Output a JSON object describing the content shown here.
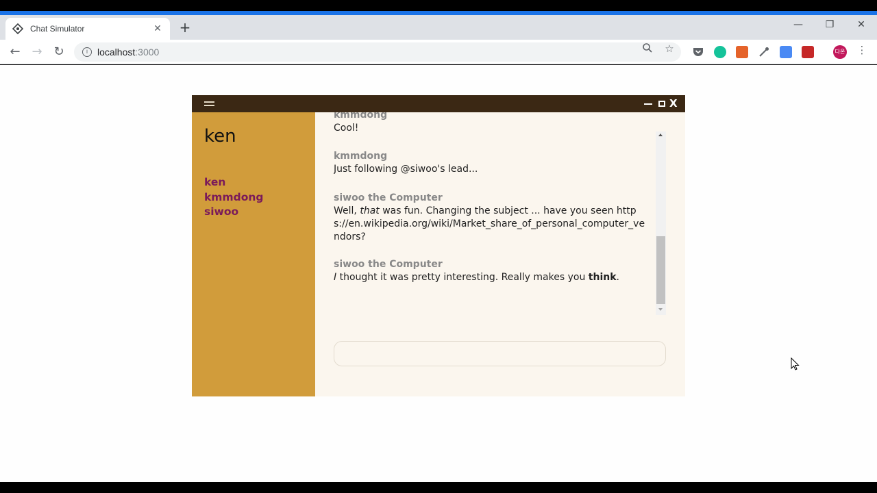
{
  "browser": {
    "tab_title": "Chat Simulator",
    "url_host": "localhost",
    "url_port": ":3000",
    "profile_label": "다온"
  },
  "app": {
    "current_user": "ken",
    "users": [
      "ken",
      "kmmdong",
      "siwoo"
    ],
    "messages": [
      {
        "author": "kmmdong",
        "text": "Cool!"
      },
      {
        "author": "kmmdong",
        "text": "Just following @siwoo's lead..."
      },
      {
        "author": "siwoo the Computer",
        "parts": [
          "Well, ",
          "that",
          " was fun. Changing the subject ... have you seen https://en.wikipedia.org/wiki/Market_share_of_personal_computer_vendors?"
        ]
      },
      {
        "author": "siwoo the Computer",
        "parts": [
          "I",
          " thought it was pretty interesting. Really makes you ",
          "think",
          "."
        ]
      }
    ],
    "composer_placeholder": ""
  },
  "colors": {
    "titlebar": "#3b2814",
    "sidebar": "#d19c3b",
    "user_link": "#7a1a5a",
    "main_bg": "#fbf6ee"
  }
}
